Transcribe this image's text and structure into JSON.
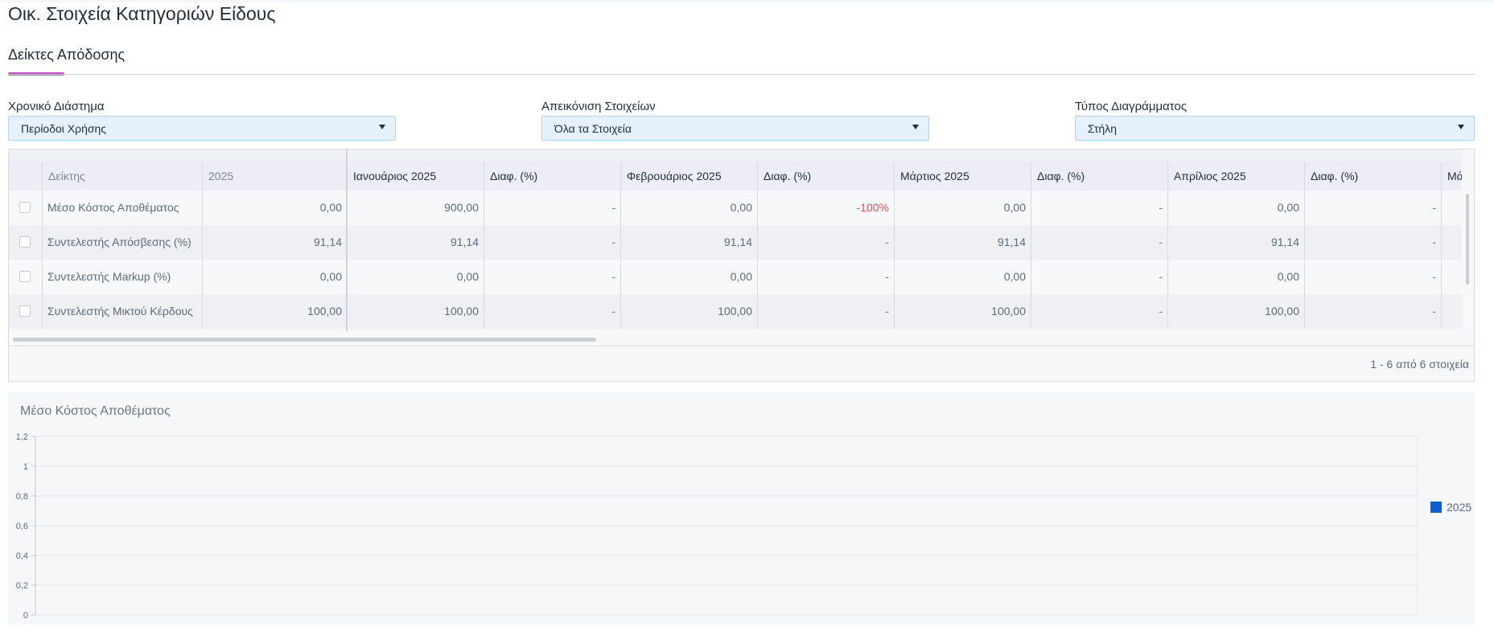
{
  "page": {
    "title": "Οικ. Στοιχεία Κατηγοριών Είδους"
  },
  "tabs": [
    {
      "label": "Δείκτες Απόδοσης",
      "active": true
    }
  ],
  "filters": [
    {
      "label": "Χρονικό Διάστημα",
      "value": "Περίοδοι Χρήσης"
    },
    {
      "label": "Απεικόνιση Στοιχείων",
      "value": "Όλα τα Στοιχεία"
    },
    {
      "label": "Τύπος Διαγράμματος",
      "value": "Στήλη"
    }
  ],
  "grid": {
    "headers": [
      "Δείκτης",
      "2025",
      "Ιανουάριος 2025",
      "Διαφ. (%)",
      "Φεβρουάριος 2025",
      "Διαφ. (%)",
      "Μάρτιος 2025",
      "Διαφ. (%)",
      "Απρίλιος 2025",
      "Διαφ. (%)",
      "Μάι"
    ],
    "rows": [
      {
        "name": "Μέσο Κόστος Αποθέματος",
        "y2025": "0,00",
        "jan": "900,00",
        "jan_diff": "-",
        "feb": "0,00",
        "feb_diff": "-100%",
        "mar": "0,00",
        "mar_diff": "-",
        "apr": "0,00",
        "apr_diff": "-"
      },
      {
        "name": "Συντελεστής Απόσβεσης (%)",
        "y2025": "91,14",
        "jan": "91,14",
        "jan_diff": "-",
        "feb": "91,14",
        "feb_diff": "-",
        "mar": "91,14",
        "mar_diff": "-",
        "apr": "91,14",
        "apr_diff": "-"
      },
      {
        "name": "Συντελεστής Markup (%)",
        "y2025": "0,00",
        "jan": "0,00",
        "jan_diff": "-",
        "feb": "0,00",
        "feb_diff": "-",
        "mar": "0,00",
        "mar_diff": "-",
        "apr": "0,00",
        "apr_diff": "-"
      },
      {
        "name": "Συντελεστής Μικτού Κέρδους",
        "y2025": "100,00",
        "jan": "100,00",
        "jan_diff": "-",
        "feb": "100,00",
        "feb_diff": "-",
        "mar": "100,00",
        "mar_diff": "-",
        "apr": "100,00",
        "apr_diff": "-"
      }
    ],
    "pager_text": "1 - 6 από 6 στοιχεία"
  },
  "chart_data": {
    "type": "bar",
    "title": "Μέσο Κόστος Αποθέματος",
    "categories": [],
    "series": [
      {
        "name": "2025",
        "values": [],
        "color": "#0b5fd3"
      }
    ],
    "yticks": [
      "0",
      "0,2",
      "0,4",
      "0,6",
      "0,8",
      "1",
      "1,2"
    ],
    "ylim": [
      0,
      1.2
    ],
    "grid": true,
    "legend": "right"
  }
}
